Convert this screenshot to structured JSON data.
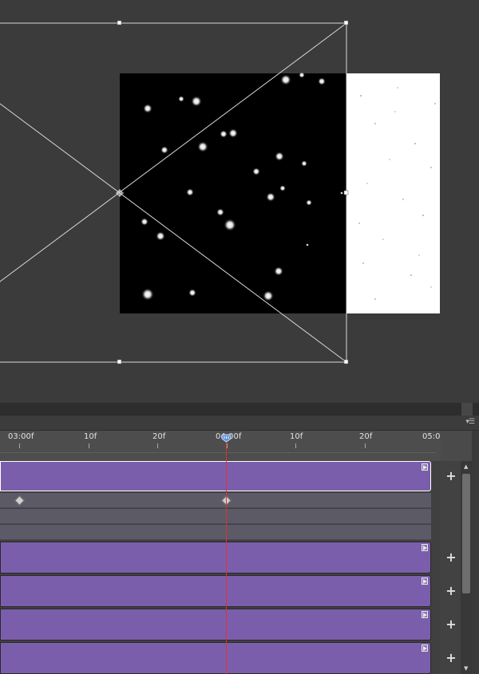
{
  "timeline": {
    "ruler_labels": [
      "03:00f",
      "10f",
      "20f",
      "04:00f",
      "10f",
      "20f",
      "05:0"
    ],
    "add_button_label": "+",
    "panel_menu_label": "▾☰"
  },
  "colors": {
    "canvas_bg": "#3b3b3b",
    "clip_fill": "#7b5eab",
    "subtrack_fill": "#5d5a68",
    "playhead": "#e03030",
    "playhead_handle": "#5d8fd6"
  }
}
